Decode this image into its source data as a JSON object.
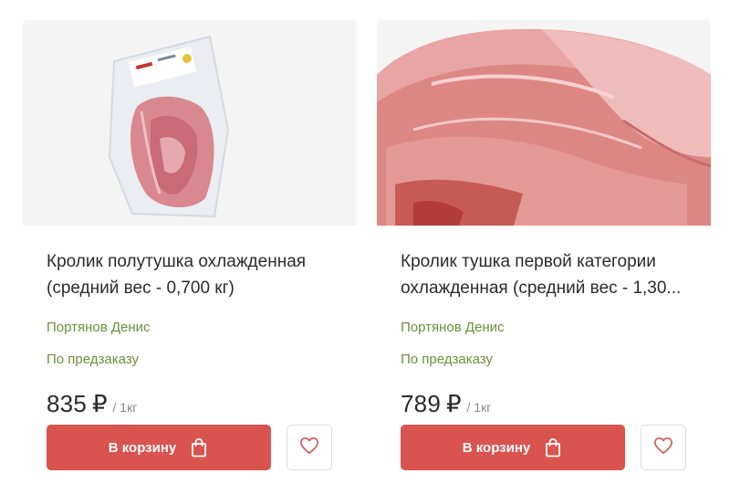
{
  "products": [
    {
      "title_line1": "Кролик полутушка охлажденная",
      "title_line2": "(средний вес - 0,700 кг)",
      "seller": "Портянов Денис",
      "availability": "По предзаказу",
      "price": "835",
      "currency": "₽",
      "unit": "/ 1кг",
      "cart_label": "В корзину",
      "image_icon": "rabbit-half-carcass-vacuum-pack-photo"
    },
    {
      "title_line1": "Кролик тушка первой категории",
      "title_line2": "охлажденная (средний вес - 1,30...",
      "seller": "Портянов Денис",
      "availability": "По предзаказу",
      "price": "789",
      "currency": "₽",
      "unit": "/ 1кг",
      "cart_label": "В корзину",
      "image_icon": "rabbit-whole-carcass-photo"
    }
  ],
  "colors": {
    "accent_button": "#d9534f",
    "seller_green": "#6a8f3a",
    "text_dark": "#2b2b2b",
    "unit_gray": "#8a8a8a",
    "heart_red": "#d9534f"
  },
  "icons": {
    "cart": "shopping-bag-icon",
    "favorite": "heart-outline-icon"
  }
}
